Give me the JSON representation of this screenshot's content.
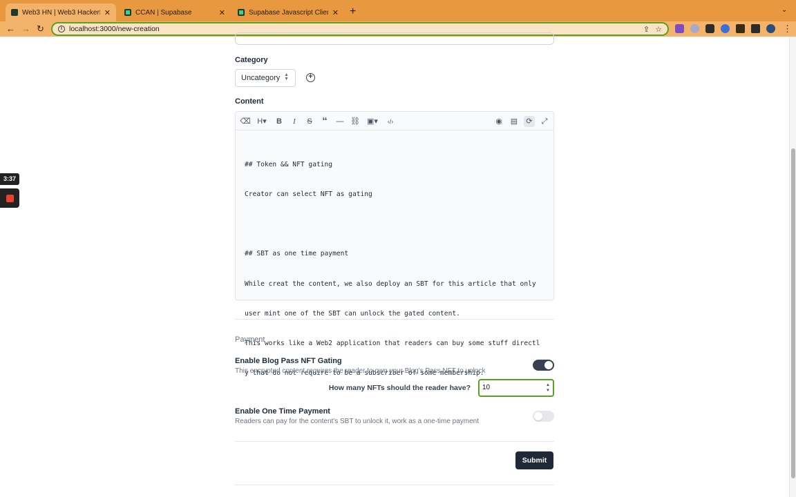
{
  "browser": {
    "tabs": [
      {
        "title": "Web3 HN | Web3 HackerNews",
        "active": true
      },
      {
        "title": "CCAN | Supabase",
        "active": false
      },
      {
        "title": "Supabase Javascript Client",
        "active": false
      }
    ],
    "new_tab": "+",
    "url": "localhost:3000/new-creation"
  },
  "recorder": {
    "time": "3:37"
  },
  "form": {
    "category": {
      "label": "Category",
      "selected": "Uncategory"
    },
    "content": {
      "label": "Content",
      "tools": [
        "eraser-icon",
        "heading-icon",
        "bold-icon",
        "italic-icon",
        "strikethrough-icon",
        "quote-icon",
        "horizontal-rule-icon",
        "link-icon",
        "image-icon",
        "code-icon",
        "preview-icon",
        "layout-icon",
        "sync-scroll-icon",
        "fullscreen-icon"
      ],
      "tool_glyphs": {
        "heading": "H",
        "bold": "B",
        "italic": "I",
        "strike": "S",
        "quote": "“",
        "hr": "—",
        "code": "‹/›"
      },
      "lines": [
        "## Token && NFT gating",
        "Creator can select NFT as gating",
        "",
        "## SBT as one time payment",
        "While creat the content, we also deploy an SBT for this article that only",
        "user mint one of the SBT can unlock the gated content.",
        "This works like a Web2 application that readers can buy some stuff directl",
        "y that do not require to be a subscriber of some membership."
      ]
    },
    "payment": {
      "section_title": "Payment",
      "nft_gating": {
        "title": "Enable Blog Pass NFT Gating",
        "description": "This encrypted content requires the reader to own your Blog's Pass NFT to unlock",
        "enabled": true,
        "question": "How many NFTs should the reader have?",
        "value": "10"
      },
      "one_time": {
        "title": "Enable One Time Payment",
        "description": "Readers can pay for the content's SBT to unlock it, work as a one-time payment",
        "enabled": false
      }
    },
    "submit_label": "Submit"
  },
  "colors": {
    "tab_bar": "#e8983e",
    "toolbar": "#f3b36a",
    "focus_ring": "#58a21f",
    "primary_button": "#1f2937",
    "recorder_stop": "#e8412c"
  }
}
